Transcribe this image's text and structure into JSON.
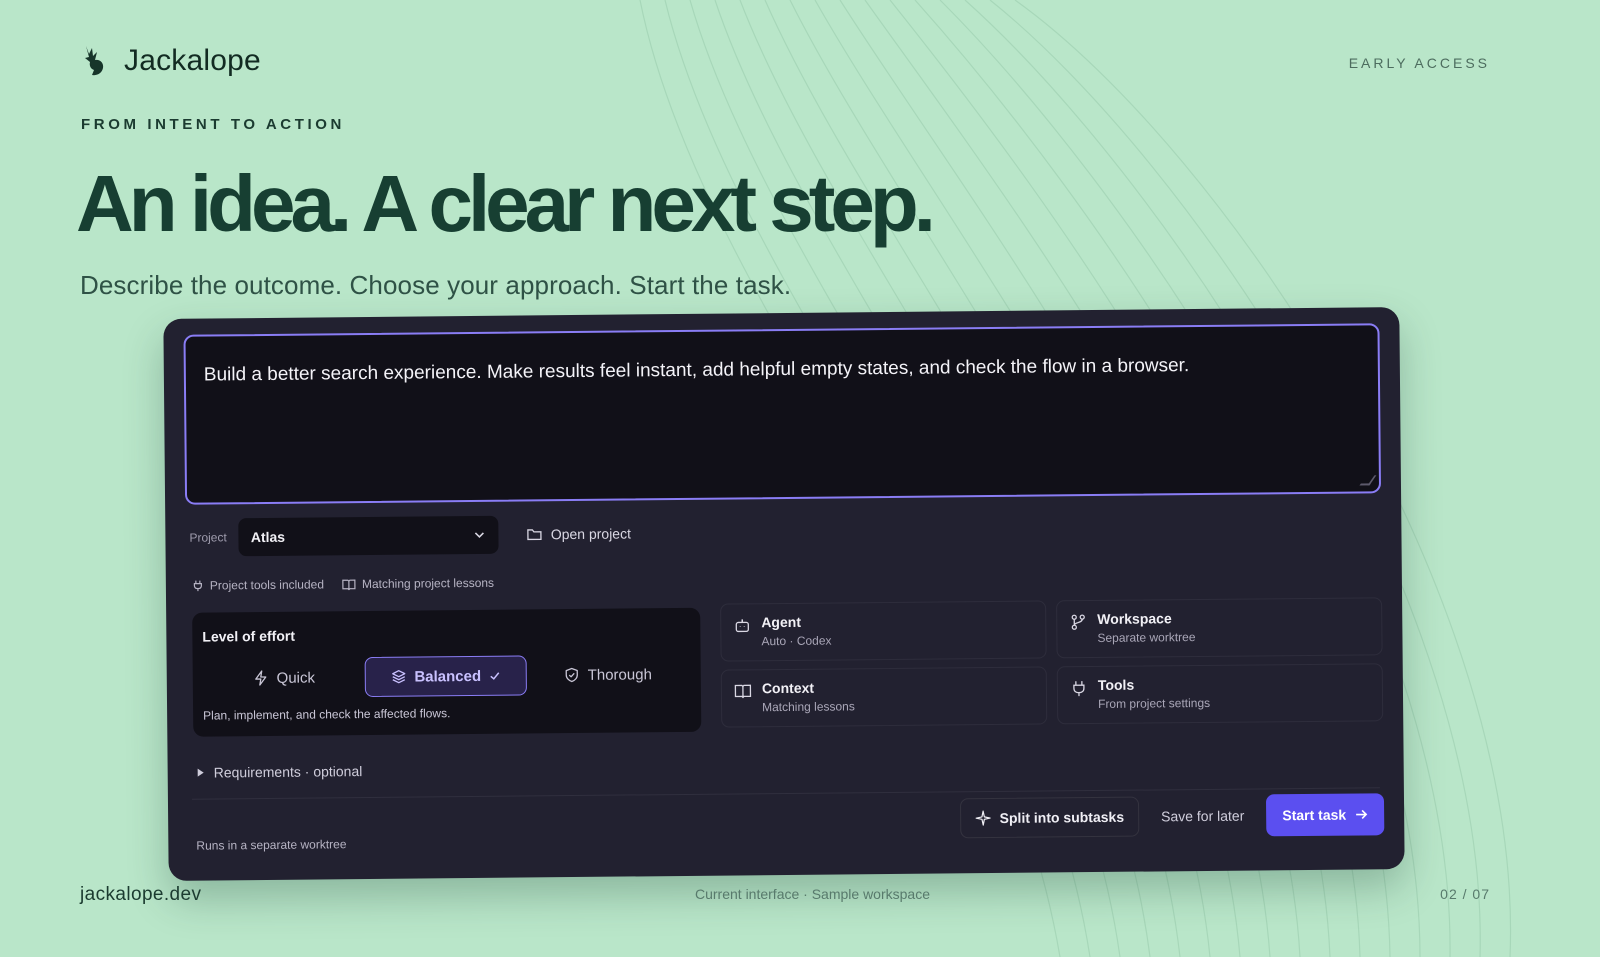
{
  "brand": {
    "name": "Jackalope",
    "logo_icon": "jackalope-logo-icon"
  },
  "header": {
    "badge": "EARLY ACCESS"
  },
  "hero": {
    "eyebrow": "FROM INTENT TO ACTION",
    "headline": "An idea. A clear next step.",
    "subline": "Describe the outcome. Choose your approach. Start the task."
  },
  "composer": {
    "prompt_text": "Build a better search experience. Make results feel instant, add helpful empty states, and check the flow in a browser.",
    "project_label": "Project",
    "project_value": "Atlas",
    "open_project": "Open project",
    "meta": [
      "Project tools included",
      "Matching project lessons"
    ],
    "effort": {
      "title": "Level of effort",
      "options": [
        "Quick",
        "Balanced",
        "Thorough"
      ],
      "selected": "Balanced",
      "description": "Plan, implement, and check the affected flows."
    },
    "cards": [
      {
        "title": "Agent",
        "subtitle": "Auto · Codex",
        "icon": "robot-icon"
      },
      {
        "title": "Workspace",
        "subtitle": "Separate worktree",
        "icon": "branch-icon"
      },
      {
        "title": "Context",
        "subtitle": "Matching lessons",
        "icon": "book-icon"
      },
      {
        "title": "Tools",
        "subtitle": "From project settings",
        "icon": "plug-icon"
      }
    ],
    "requirements": "Requirements · optional",
    "runs_note": "Runs in a separate worktree",
    "actions": {
      "split": "Split into subtasks",
      "save": "Save for later",
      "start": "Start task"
    }
  },
  "footer": {
    "site": "jackalope.dev",
    "caption": "Current interface · Sample workspace",
    "page": "02 / 07"
  },
  "colors": {
    "background": "#b9e6c9",
    "panel": "#222130",
    "accent": "#5b4ff0",
    "accent_border": "#8a7df5",
    "headline": "#173f32"
  }
}
